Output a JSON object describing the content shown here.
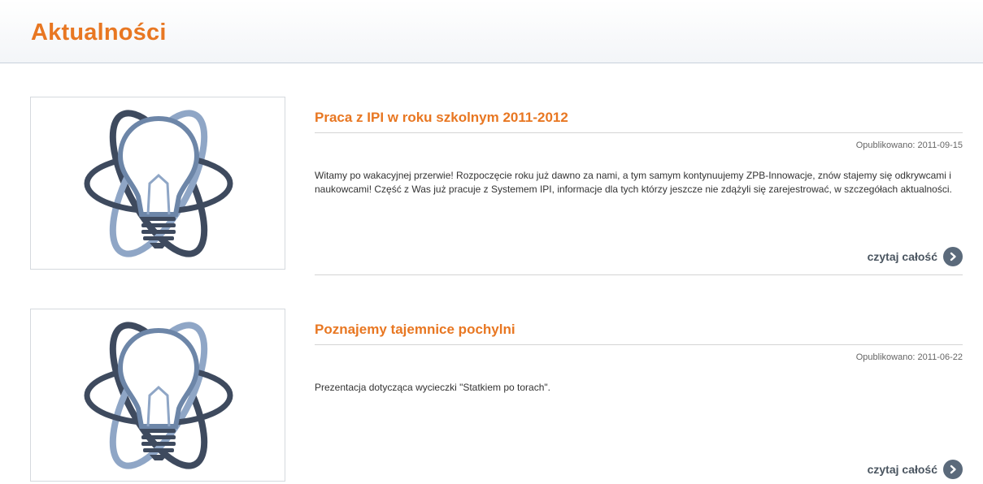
{
  "header": {
    "title": "Aktualności"
  },
  "news": [
    {
      "title": "Praca z IPI w roku szkolnym 2011-2012",
      "published": "Opublikowano: 2011-09-15",
      "excerpt": "Witamy po wakacyjnej przerwie! Rozpoczęcie roku już dawno za nami, a tym samym kontynuujemy ZPB-Innowacje, znów stajemy się odkrywcami i naukowcami! Część z Was już pracuje z Systemem IPI, informacje dla tych którzy jeszcze nie zdążyli się zarejestrować, w szczegółach aktualności.",
      "read_more": "czytaj całość",
      "image_icon": "lightbulb-atom-icon"
    },
    {
      "title": "Poznajemy tajemnice pochylni",
      "published": "Opublikowano: 2011-06-22",
      "excerpt": "Prezentacja dotycząca wycieczki \"Statkiem po torach\".",
      "read_more": "czytaj całość",
      "image_icon": "lightbulb-atom-icon"
    }
  ],
  "colors": {
    "accent": "#e87722",
    "button": "#5b6a7b",
    "text": "#333333",
    "orbit_dark": "#3e4a5e",
    "orbit_light": "#8fa6c6"
  }
}
